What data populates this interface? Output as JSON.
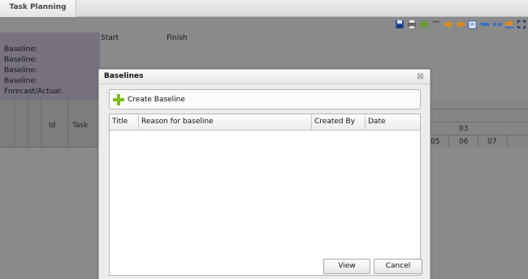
{
  "tabs": [
    {
      "label": "Task Planning"
    }
  ],
  "toolbar": {
    "icons": [
      "save-icon",
      "print-icon",
      "add-icon",
      "delete-icon",
      "arrow-right-icon",
      "arrow-left-icon",
      "edit-icon",
      "link-icon",
      "unlink-icon",
      "baseline-icon",
      "fullscreen-icon"
    ]
  },
  "baseline_panel": {
    "rows": [
      "Baseline:",
      "Baseline:",
      "Baseline:",
      "Baseline:",
      "Forecast/Actual:"
    ],
    "start_label": "Start",
    "finish_label": "Finish"
  },
  "task_grid": {
    "columns": [
      "Id",
      "Task"
    ]
  },
  "gantt_header": {
    "top_label": "03",
    "days": [
      "05",
      "06",
      "07"
    ]
  },
  "dialog": {
    "title": "Baselines",
    "close_glyph": "⊠",
    "create_label": "Create Baseline",
    "columns": [
      "Title",
      "Reason for baseline",
      "Created By",
      "Date"
    ],
    "rows": [],
    "view_label": "View",
    "cancel_label": "Cancel"
  },
  "colors": {
    "overlay_bg": "#8a8a8a",
    "dialog_bg": "#ececec",
    "accent_green": "#7dbb1e"
  }
}
